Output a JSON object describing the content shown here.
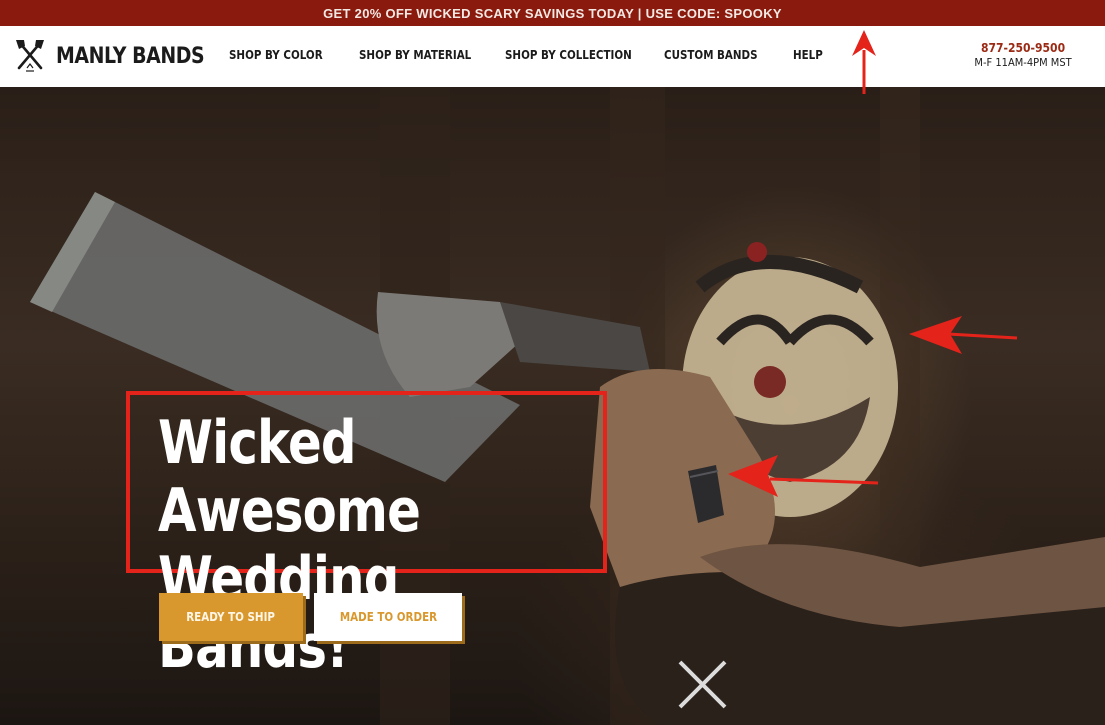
{
  "promo": {
    "text": "GET 20% OFF WICKED SCARY SAVINGS TODAY | USE CODE: SPOOKY"
  },
  "brand": {
    "name": "MANLY BANDS"
  },
  "nav": {
    "items": [
      {
        "label": "SHOP BY COLOR"
      },
      {
        "label": "SHOP BY MATERIAL"
      },
      {
        "label": "SHOP BY COLLECTION"
      },
      {
        "label": "CUSTOM BANDS"
      },
      {
        "label": "HELP"
      }
    ]
  },
  "contact": {
    "phone": "877-250-9500",
    "hours": "M-F 11AM-4PM MST"
  },
  "hero": {
    "headline_line1": "Wicked Awesome",
    "headline_line2": "Wedding Bands!",
    "buttons": {
      "ready": "READY TO SHIP",
      "order": "MADE TO ORDER"
    }
  },
  "colors": {
    "promo_bg": "#8b1a0e",
    "accent_gold": "#d9982e",
    "annotation_red": "#e4231b",
    "phone_red": "#9b2a14"
  },
  "icons": {
    "logo": "crossed-axes-icon",
    "annotation": "red-arrow-icon"
  }
}
